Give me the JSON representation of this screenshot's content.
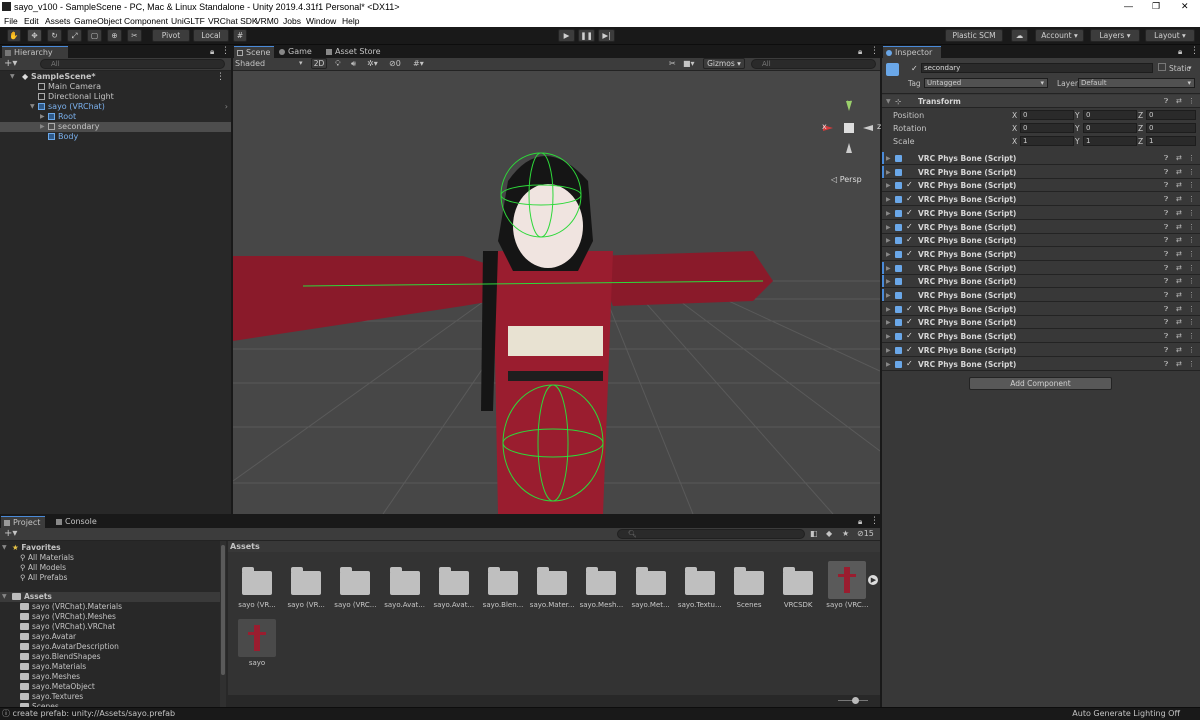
{
  "window": {
    "title": "sayo_v100 - SampleScene - PC, Mac & Linux Standalone - Unity 2019.4.31f1 Personal* <DX11>"
  },
  "menu": [
    "File",
    "Edit",
    "Assets",
    "GameObject",
    "Component",
    "UniGLTF",
    "VRChat SDK",
    "VRM0",
    "Jobs",
    "Window",
    "Help"
  ],
  "toolbar": {
    "pivot": "Pivot",
    "local": "Local",
    "plastic": "Plastic SCM",
    "account": "Account",
    "layers": "Layers",
    "layout": "Layout"
  },
  "hierarchy": {
    "tab": "Hierarchy",
    "search_placeholder": "All",
    "items": [
      {
        "label": "SampleScene*"
      },
      {
        "label": "Main Camera"
      },
      {
        "label": "Directional Light"
      },
      {
        "label": "sayo (VRChat)"
      },
      {
        "label": "Root"
      },
      {
        "label": "secondary"
      },
      {
        "label": "Body"
      }
    ]
  },
  "scene": {
    "tabs": [
      "Scene",
      "Game",
      "Asset Store"
    ],
    "shading": "Shaded",
    "mode_2d": "2D",
    "fx_count": "0",
    "gizmos": "Gizmos",
    "search_placeholder": "All",
    "persp": "Persp",
    "axis_x": "x",
    "axis_y": "y",
    "axis_z": "z"
  },
  "inspector": {
    "tab": "Inspector",
    "object_name": "secondary",
    "static_label": "Static",
    "tag_label": "Tag",
    "tag_value": "Untagged",
    "layer_label": "Layer",
    "layer_value": "Default",
    "transform": {
      "title": "Transform",
      "position_label": "Position",
      "rotation_label": "Rotation",
      "scale_label": "Scale",
      "position": [
        "0",
        "0",
        "0"
      ],
      "rotation": [
        "0",
        "0",
        "0"
      ],
      "scale": [
        "1",
        "1",
        "1"
      ]
    },
    "components": [
      {
        "label": "VRC Phys Bone (Script)",
        "checked": false
      },
      {
        "label": "VRC Phys Bone (Script)",
        "checked": false
      },
      {
        "label": "VRC Phys Bone (Script)",
        "checked": true
      },
      {
        "label": "VRC Phys Bone (Script)",
        "checked": true
      },
      {
        "label": "VRC Phys Bone (Script)",
        "checked": true
      },
      {
        "label": "VRC Phys Bone (Script)",
        "checked": true
      },
      {
        "label": "VRC Phys Bone (Script)",
        "checked": true
      },
      {
        "label": "VRC Phys Bone (Script)",
        "checked": true
      },
      {
        "label": "VRC Phys Bone (Script)",
        "checked": false
      },
      {
        "label": "VRC Phys Bone (Script)",
        "checked": false
      },
      {
        "label": "VRC Phys Bone (Script)",
        "checked": false
      },
      {
        "label": "VRC Phys Bone (Script)",
        "checked": true
      },
      {
        "label": "VRC Phys Bone (Script)",
        "checked": true
      },
      {
        "label": "VRC Phys Bone (Script)",
        "checked": true
      },
      {
        "label": "VRC Phys Bone (Script)",
        "checked": true
      },
      {
        "label": "VRC Phys Bone (Script)",
        "checked": true
      }
    ],
    "add_component": "Add Component"
  },
  "project": {
    "tabs": [
      "Project",
      "Console"
    ],
    "hidden_count": "15",
    "favorites_label": "Favorites",
    "favorites": [
      "All Materials",
      "All Models",
      "All Prefabs"
    ],
    "assets_label": "Assets",
    "tree": [
      "sayo (VRChat).Materials",
      "sayo (VRChat).Meshes",
      "sayo (VRChat).VRChat",
      "sayo.Avatar",
      "sayo.AvatarDescription",
      "sayo.BlendShapes",
      "sayo.Materials",
      "sayo.Meshes",
      "sayo.MetaObject",
      "sayo.Textures",
      "Scenes"
    ],
    "breadcrumb": "Assets",
    "grid": [
      "sayo (VR...",
      "sayo (VR...",
      "sayo (VRC...",
      "sayo.Avat...",
      "sayo.Avat...",
      "sayo.Blen...",
      "sayo.Mater...",
      "sayo.Mesh...",
      "sayo.Met...",
      "sayo.Textu...",
      "Scenes",
      "VRCSDK",
      "sayo (VRC...",
      "sayo"
    ]
  },
  "status": {
    "left": "create prefab: unity://Assets/sayo.prefab",
    "right": "Auto Generate Lighting Off"
  }
}
